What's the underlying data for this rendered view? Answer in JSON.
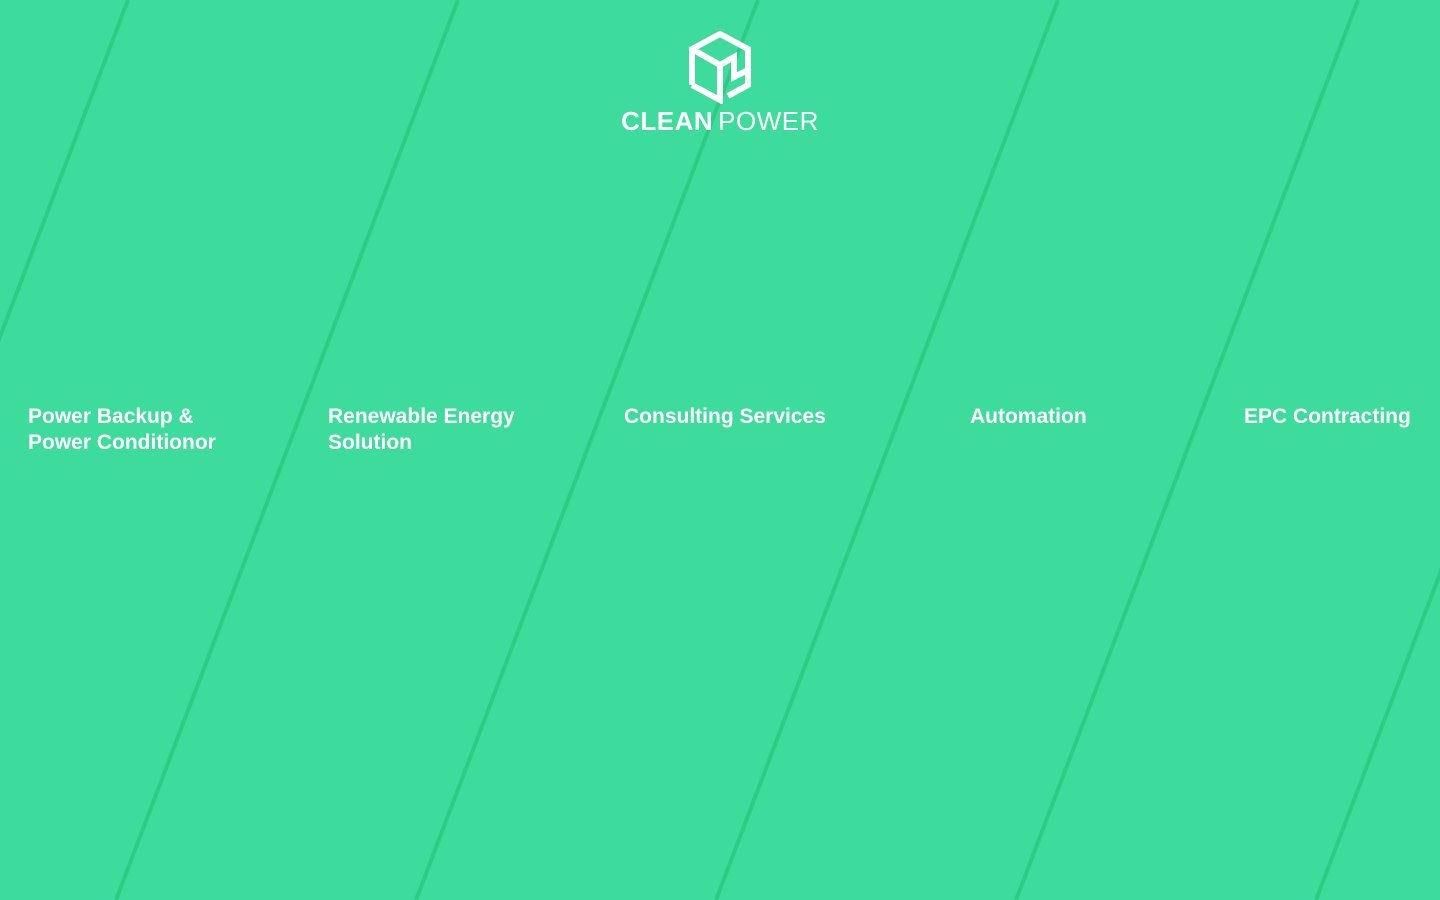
{
  "brand": {
    "word_bold": "CLEAN",
    "word_light": "POWER",
    "logo_icon": "cube-icon",
    "colors": {
      "background": "#3ddc9c",
      "stripe": "#2ecb85",
      "text": "#ffffff"
    }
  },
  "services": [
    {
      "line1": "Power Backup &",
      "line2": "Power Conditionor"
    },
    {
      "line1": "Renewable Energy",
      "line2": "Solution"
    },
    {
      "line1": "Consulting Services",
      "line2": ""
    },
    {
      "line1": "Automation",
      "line2": ""
    },
    {
      "line1": "EPC Contracting",
      "line2": ""
    }
  ]
}
